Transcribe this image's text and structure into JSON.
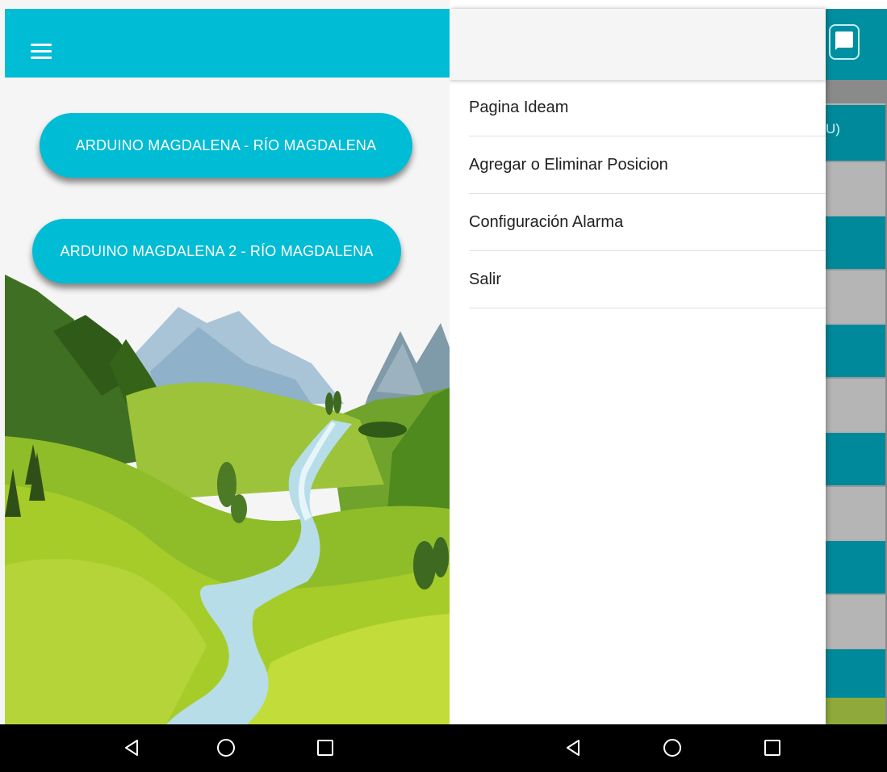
{
  "left_screen": {
    "buttons": [
      {
        "label": "ARDUINO MAGDALENA - RÍO MAGDALENA"
      },
      {
        "label": "ARDUINO MAGDALENA 2 - RÍO MAGDALENA"
      }
    ],
    "background_image": "river-landscape-illustration"
  },
  "right_screen": {
    "drawer": {
      "items": [
        {
          "label": "Pagina Ideam"
        },
        {
          "label": "Agregar o Eliminar Posicion"
        },
        {
          "label": "Configuración Alarma"
        },
        {
          "label": "Salir"
        }
      ]
    },
    "behind": {
      "partial_text": "U)"
    }
  },
  "nav_bar": {
    "icons": [
      "back-triangle-icon",
      "home-circle-icon",
      "recents-square-icon"
    ]
  },
  "colors": {
    "accent": "#00bcd4",
    "accent_dark": "#008fa0",
    "nav_bar": "#000000"
  }
}
